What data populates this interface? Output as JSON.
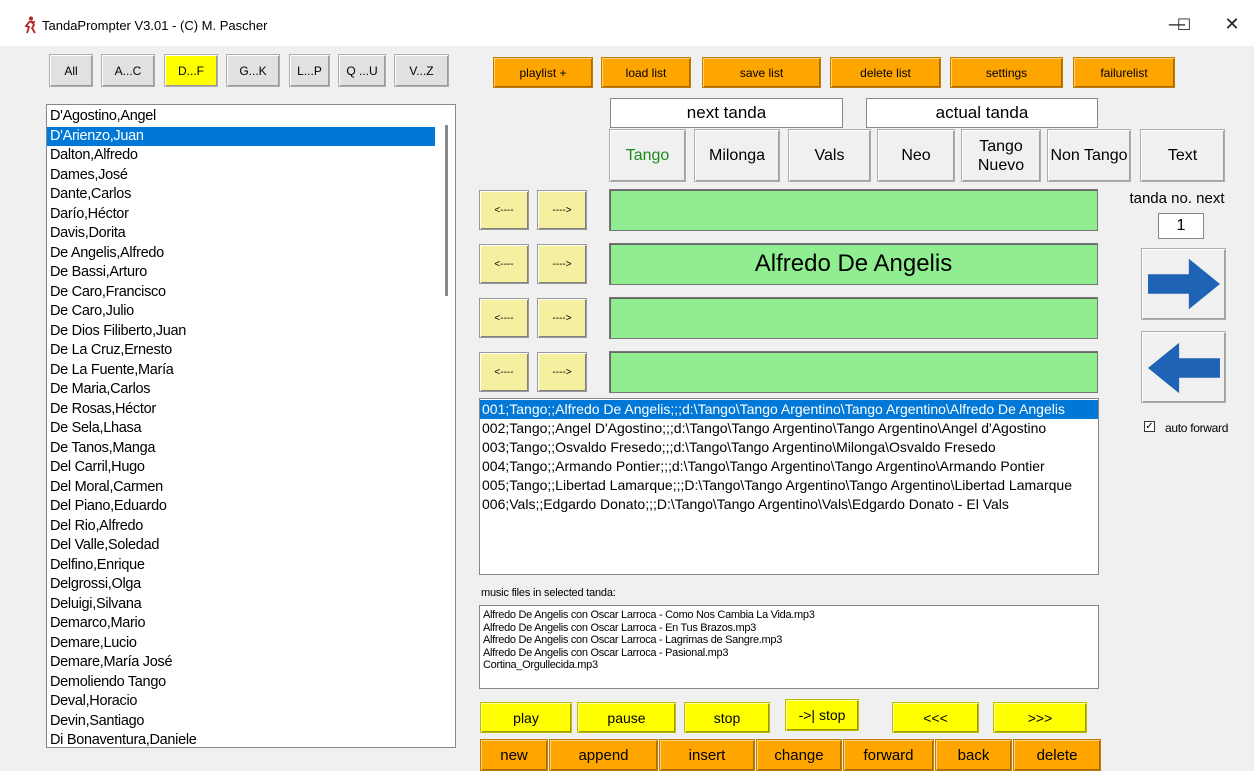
{
  "window": {
    "title": "TandaPrompter V3.01 - (C) M. Pascher",
    "minimize": "—",
    "maximize": "☐",
    "close": "✕"
  },
  "alpha_filter": [
    {
      "label": "All",
      "active": false
    },
    {
      "label": "A...C",
      "active": false
    },
    {
      "label": "D...F",
      "active": true
    },
    {
      "label": "G...K",
      "active": false
    },
    {
      "label": "L...P",
      "active": false
    },
    {
      "label": "Q ...U",
      "active": false
    },
    {
      "label": "V...Z",
      "active": false
    }
  ],
  "artists": [
    "D'Agostino,Angel",
    "D'Arienzo,Juan",
    "Dalton,Alfredo",
    "Dames,José",
    "Dante,Carlos",
    "Darío,Héctor",
    "Davis,Dorita",
    "De Angelis,Alfredo",
    "De Bassi,Arturo",
    "De Caro,Francisco",
    "De Caro,Julio",
    "De Dios Filiberto,Juan",
    "De La Cruz,Ernesto",
    "De La Fuente,María",
    "De Maria,Carlos",
    "De Rosas,Héctor",
    "De Sela,Lhasa",
    "De Tanos,Manga",
    "Del Carril,Hugo",
    "Del Moral,Carmen",
    "Del Piano,Eduardo",
    "Del Rio,Alfredo",
    "Del Valle,Soledad",
    "Delfino,Enrique",
    "Delgrossi,Olga",
    "Deluigi,Silvana",
    "Demarco,Mario",
    "Demare,Lucio",
    "Demare,María José",
    "Demoliendo Tango",
    "Deval,Horacio",
    "Devin,Santiago",
    "Di Bonaventura,Daniele"
  ],
  "selected_artist_index": 1,
  "top_buttons": [
    "playlist +",
    "load list",
    "save list",
    "delete list",
    "settings",
    "failurelist"
  ],
  "headers": {
    "next": "next tanda",
    "actual": "actual tanda"
  },
  "categories": [
    {
      "label": "Tango",
      "active": true
    },
    {
      "label": "Milonga",
      "active": false
    },
    {
      "label": "Vals",
      "active": false
    },
    {
      "label": "Neo",
      "active": false
    },
    {
      "label": "Tango Nuevo",
      "active": false
    },
    {
      "label": "Non Tango",
      "active": false
    },
    {
      "label": "Text",
      "active": false
    }
  ],
  "slots": [
    {
      "left": "<----",
      "right": "---->",
      "text": ""
    },
    {
      "left": "<----",
      "right": "---->",
      "text": "Alfredo De Angelis"
    },
    {
      "left": "<----",
      "right": "---->",
      "text": ""
    },
    {
      "left": "<----",
      "right": "---->",
      "text": ""
    }
  ],
  "tanda_no": {
    "label": "tanda no. next",
    "value": "1"
  },
  "auto_forward": {
    "label": "auto forward",
    "checked": true
  },
  "tandas": [
    "001;Tango;;Alfredo De Angelis;;;d:\\Tango\\Tango Argentino\\Tango Argentino\\Alfredo De Angelis",
    "002;Tango;;Angel D'Agostino;;;d:\\Tango\\Tango Argentino\\Tango Argentino\\Angel d'Agostino",
    "003;Tango;;Osvaldo Fresedo;;;d:\\Tango\\Tango Argentino\\Milonga\\Osvaldo Fresedo",
    "004;Tango;;Armando Pontier;;;d:\\Tango\\Tango Argentino\\Tango Argentino\\Armando Pontier",
    "005;Tango;;Libertad Lamarque;;;D:\\Tango\\Tango Argentino\\Tango Argentino\\Libertad Lamarque",
    "006;Vals;;Edgardo Donato;;;D:\\Tango\\Tango Argentino\\Vals\\Edgardo Donato - El Vals"
  ],
  "music_files": {
    "label": "music files in selected tanda:",
    "files": [
      "Alfredo De Angelis con Oscar Larroca - Como Nos Cambia La Vida.mp3",
      "Alfredo De Angelis con Oscar Larroca - En Tus Brazos.mp3",
      "Alfredo De Angelis con Oscar Larroca - Lagrimas de Sangre.mp3",
      "Alfredo De Angelis con Oscar Larroca - Pasional.mp3",
      "Cortina_Orgullecida.mp3"
    ]
  },
  "player_buttons": [
    "play",
    "pause",
    "stop",
    "->| stop",
    "<<<",
    ">>>"
  ],
  "edit_buttons": [
    "new",
    "append",
    "insert",
    "change",
    "forward",
    "back",
    "delete"
  ],
  "colors": {
    "orange": "#ffa500",
    "yellow": "#ffff00",
    "green": "#90ee90",
    "selection": "#0078d7",
    "arrow_blue": "#1e63b4"
  }
}
